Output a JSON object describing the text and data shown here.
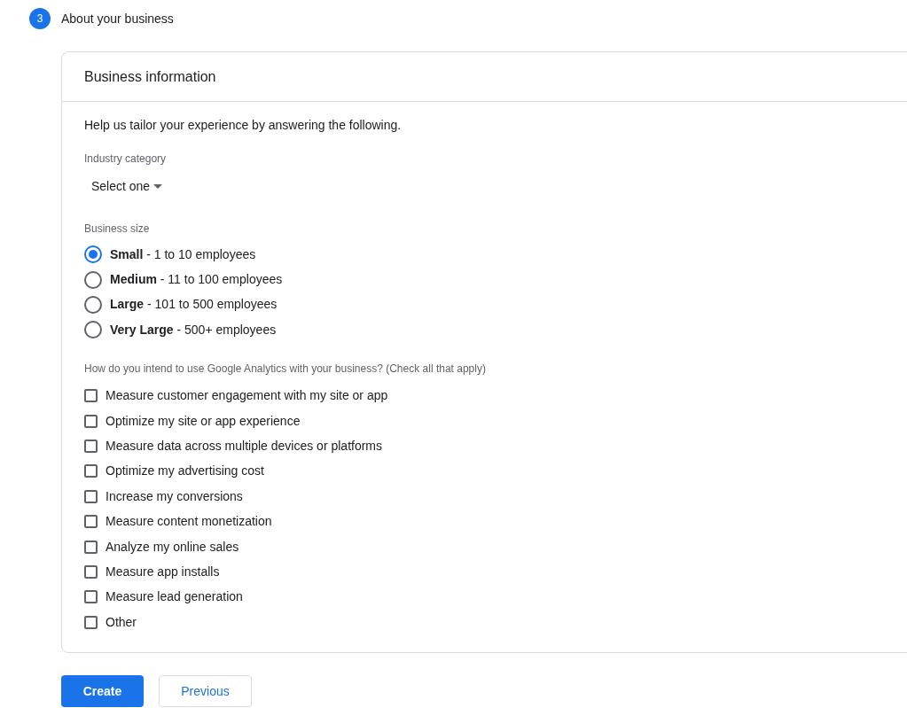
{
  "step": {
    "number": "3",
    "title": "About your business"
  },
  "card": {
    "title": "Business information",
    "intro": "Help us tailor your experience by answering the following.",
    "industry": {
      "label": "Industry category",
      "value": "Select one"
    },
    "size": {
      "label": "Business size",
      "options": [
        {
          "text": "**Small** - 1 to 10 employees",
          "selected": true
        },
        {
          "text": "**Medium** - 11 to 100 employees",
          "selected": false
        },
        {
          "text": "**Large** - 101 to 500 employees",
          "selected": false
        },
        {
          "text": "**Very Large** - 500+ employees",
          "selected": false
        }
      ]
    },
    "usage": {
      "label": "How do you intend to use Google Analytics with your business? (Check all that apply)",
      "options": [
        {
          "label": "Measure customer engagement with my site or app",
          "checked": false
        },
        {
          "label": "Optimize my site or app experience",
          "checked": false
        },
        {
          "label": "Measure data across multiple devices or platforms",
          "checked": false
        },
        {
          "label": "Optimize my advertising cost",
          "checked": false
        },
        {
          "label": "Increase my conversions",
          "checked": false
        },
        {
          "label": "Measure content monetization",
          "checked": false
        },
        {
          "label": "Analyze my online sales",
          "checked": false
        },
        {
          "label": "Measure app installs",
          "checked": false
        },
        {
          "label": "Measure lead generation",
          "checked": false
        },
        {
          "label": "Other",
          "checked": false
        }
      ]
    }
  },
  "buttons": [
    {
      "label": "Create",
      "kind": "primary"
    },
    {
      "label": "Previous",
      "kind": "secondary"
    }
  ]
}
